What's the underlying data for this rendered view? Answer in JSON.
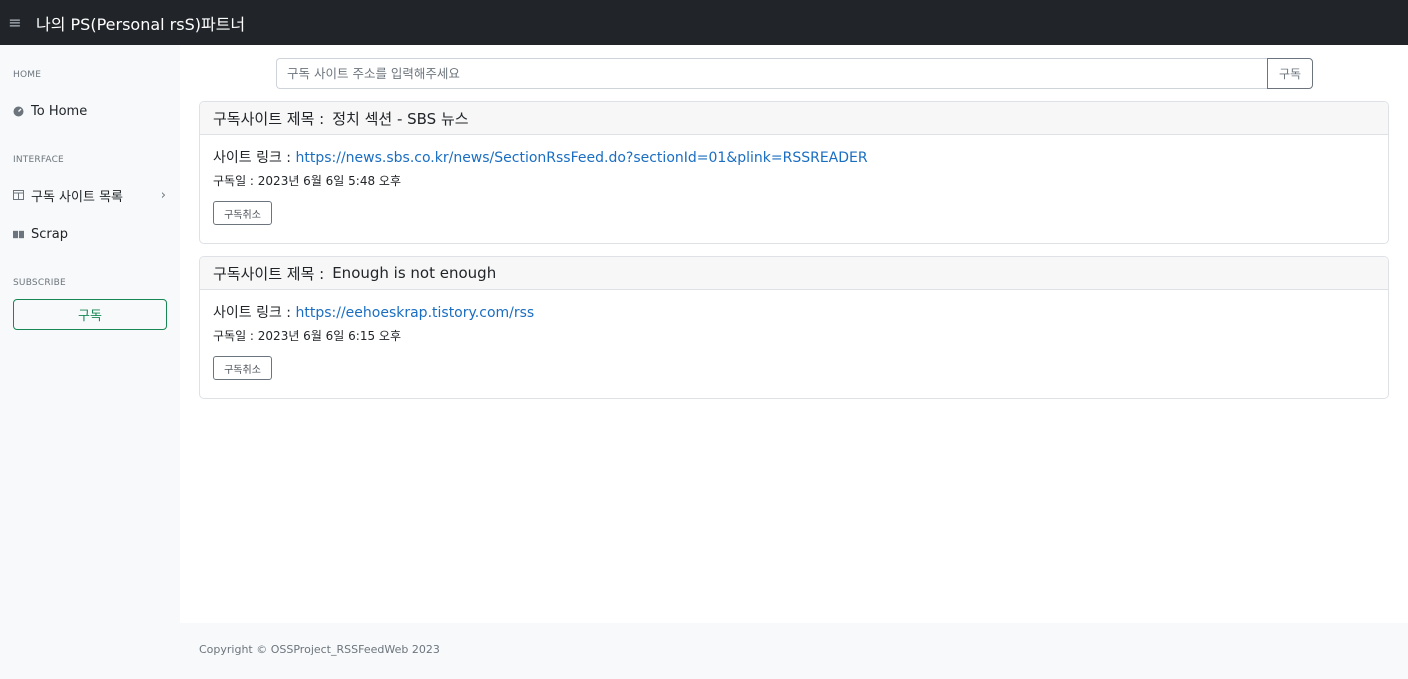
{
  "app": {
    "menu_icon": "hamburger-icon",
    "title": "나의 PS(Personal rsS)파트너"
  },
  "sidebar": {
    "sections": [
      {
        "heading": "HOME"
      },
      {
        "heading": "INTERFACE"
      },
      {
        "heading": "SUBSCRIBE"
      }
    ],
    "items": [
      {
        "label": "To Home",
        "icon": "dashboard-icon"
      },
      {
        "label": "구독 사이트 목록",
        "icon": "columns-icon",
        "chevron": "›"
      },
      {
        "label": "Scrap",
        "icon": "book-icon"
      }
    ],
    "subscribe_button": "구독"
  },
  "search": {
    "placeholder": "구독 사이트 주소를 입력해주세요",
    "button": "구독"
  },
  "cards": [
    {
      "title_prefix": "구독사이트 제목 :",
      "title": "정치 섹션 - SBS 뉴스",
      "link_prefix": "사이트 링크 :",
      "link": "https://news.sbs.co.kr/news/SectionRssFeed.do?sectionId=01&plink=RSSREADER",
      "date": "구독일 : 2023년 6월 6일 5:48 오후",
      "unsubscribe": "구독취소"
    },
    {
      "title_prefix": "구독사이트 제목 :",
      "title": "Enough is not enough",
      "link_prefix": "사이트 링크 :",
      "link": "https://eehoeskrap.tistory.com/rss",
      "date": "구독일 : 2023년 6월 6일 6:15 오후",
      "unsubscribe": "구독취소"
    }
  ],
  "footer": {
    "copyright": "Copyright © OSSProject_RSSFeedWeb 2023"
  },
  "colors": {
    "topbar": "#212529",
    "subscribe_green": "#198754",
    "link_blue": "#1a6ec2"
  }
}
